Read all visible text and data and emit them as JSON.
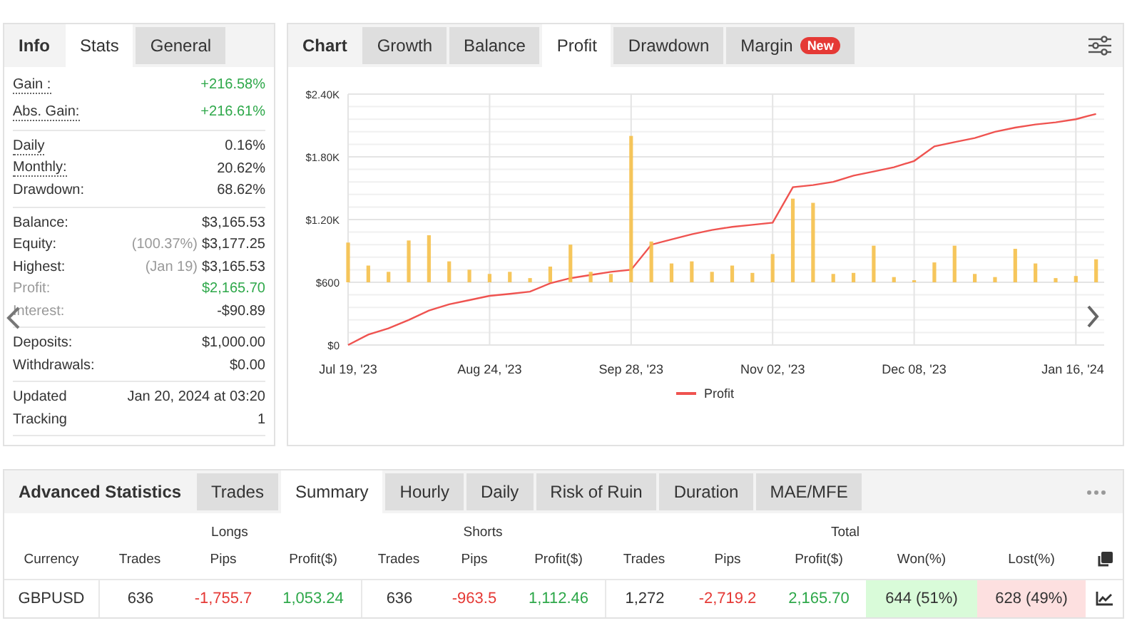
{
  "stats_panel": {
    "title": "Info",
    "tabs": [
      {
        "label": "Stats",
        "selected": true
      },
      {
        "label": "General",
        "selected": false
      }
    ],
    "groups": [
      [
        {
          "label": "Gain :",
          "value": "+216.58%",
          "positive": true,
          "underlined": true,
          "muted": false
        },
        {
          "label": "Abs. Gain:",
          "value": "+216.61%",
          "positive": true,
          "underlined": true,
          "muted": false
        }
      ],
      [
        {
          "label": "Daily",
          "value": "0.16%",
          "positive": false,
          "underlined": true,
          "muted": false
        },
        {
          "label": "Monthly:",
          "value": "20.62%",
          "positive": false,
          "underlined": true,
          "muted": false
        },
        {
          "label": "Drawdown:",
          "value": "68.62%",
          "positive": false,
          "underlined": false,
          "muted": false
        }
      ],
      [
        {
          "label": "Balance:",
          "value": "$3,165.53",
          "positive": false,
          "underlined": false,
          "muted": false
        },
        {
          "label": "Equity:",
          "note": "(100.37%)",
          "value": "$3,177.25",
          "positive": false,
          "underlined": false,
          "muted": false
        },
        {
          "label": "Highest:",
          "note": "(Jan 19)",
          "value": "$3,165.53",
          "positive": false,
          "underlined": false,
          "muted": false
        },
        {
          "label": "Profit:",
          "value": "$2,165.70",
          "positive": true,
          "underlined": false,
          "muted": true
        },
        {
          "label": "Interest:",
          "value": "-$90.89",
          "positive": false,
          "underlined": false,
          "muted": true
        }
      ],
      [
        {
          "label": "Deposits:",
          "value": "$1,000.00",
          "positive": false,
          "underlined": false,
          "muted": false
        },
        {
          "label": "Withdrawals:",
          "value": "$0.00",
          "positive": false,
          "underlined": false,
          "muted": false
        }
      ],
      [
        {
          "label": "Updated",
          "value": "Jan 20, 2024 at 03:20",
          "positive": false,
          "underlined": false,
          "muted": false
        },
        {
          "label": "Tracking",
          "value": "1",
          "positive": false,
          "underlined": false,
          "muted": false
        }
      ]
    ]
  },
  "chart_panel": {
    "title": "Chart",
    "tabs": [
      {
        "label": "Growth",
        "selected": false
      },
      {
        "label": "Balance",
        "selected": false
      },
      {
        "label": "Profit",
        "selected": true
      },
      {
        "label": "Drawdown",
        "selected": false
      },
      {
        "label": "Margin",
        "selected": false,
        "badge": "New"
      }
    ],
    "chart_data": {
      "type": "line",
      "grid": true,
      "categories": [
        "Jul 19, '23",
        null,
        null,
        null,
        null,
        null,
        null,
        "Aug 24, '23",
        null,
        null,
        null,
        null,
        null,
        null,
        "Sep 28, '23",
        null,
        null,
        null,
        null,
        null,
        null,
        "Nov 02, '23",
        null,
        null,
        null,
        null,
        null,
        null,
        "Dec 08, '23",
        null,
        null,
        null,
        null,
        null,
        null,
        null,
        "Jan 16, '24",
        null
      ],
      "ylim": [
        0,
        2400
      ],
      "yticks": [
        {
          "value": 0,
          "label": "$0"
        },
        {
          "value": 600,
          "label": "$600"
        },
        {
          "value": 1200,
          "label": "$1.20K"
        },
        {
          "value": 1800,
          "label": "$1.80K"
        },
        {
          "value": 2400,
          "label": "$2.40K"
        }
      ],
      "series": [
        {
          "name": "Profit",
          "color": "#ef5350",
          "values": [
            0,
            100,
            160,
            240,
            330,
            390,
            430,
            470,
            490,
            510,
            590,
            640,
            670,
            700,
            720,
            960,
            1010,
            1060,
            1100,
            1130,
            1150,
            1170,
            1510,
            1530,
            1560,
            1620,
            1660,
            1700,
            1760,
            1900,
            1940,
            1980,
            2040,
            2080,
            2110,
            2130,
            2160,
            2210
          ]
        }
      ]
    }
  },
  "stats_table": {
    "title": "Advanced Statistics",
    "tabs": [
      {
        "label": "Trades",
        "selected": false
      },
      {
        "label": "Summary",
        "selected": true
      },
      {
        "label": "Hourly",
        "selected": false
      },
      {
        "label": "Daily",
        "selected": false
      },
      {
        "label": "Risk of Ruin",
        "selected": false
      },
      {
        "label": "Duration",
        "selected": false
      },
      {
        "label": "MAE/MFE",
        "selected": false
      }
    ],
    "groups": [
      {
        "label": "Longs"
      },
      {
        "label": "Shorts"
      },
      {
        "label": "Total"
      }
    ],
    "columns": [
      "Currency",
      "Trades",
      "Pips",
      "Profit($)",
      "Trades",
      "Pips",
      "Profit($)",
      "Trades",
      "Pips",
      "Profit($)",
      "Won(%)",
      "Lost(%)"
    ],
    "rows": [
      {
        "cells": [
          {
            "text": "GBPUSD",
            "kind": "plain"
          },
          {
            "text": "636",
            "kind": "plain"
          },
          {
            "text": "-1,755.7",
            "kind": "negative"
          },
          {
            "text": "1,053.24",
            "kind": "positive"
          },
          {
            "text": "636",
            "kind": "plain"
          },
          {
            "text": "-963.5",
            "kind": "negative"
          },
          {
            "text": "1,112.46",
            "kind": "positive"
          },
          {
            "text": "1,272",
            "kind": "plain"
          },
          {
            "text": "-2,719.2",
            "kind": "negative"
          },
          {
            "text": "2,165.70",
            "kind": "positive"
          },
          {
            "text": "644 (51%)",
            "kind": "won"
          },
          {
            "text": "628 (49%)",
            "kind": "lost"
          }
        ]
      }
    ]
  }
}
